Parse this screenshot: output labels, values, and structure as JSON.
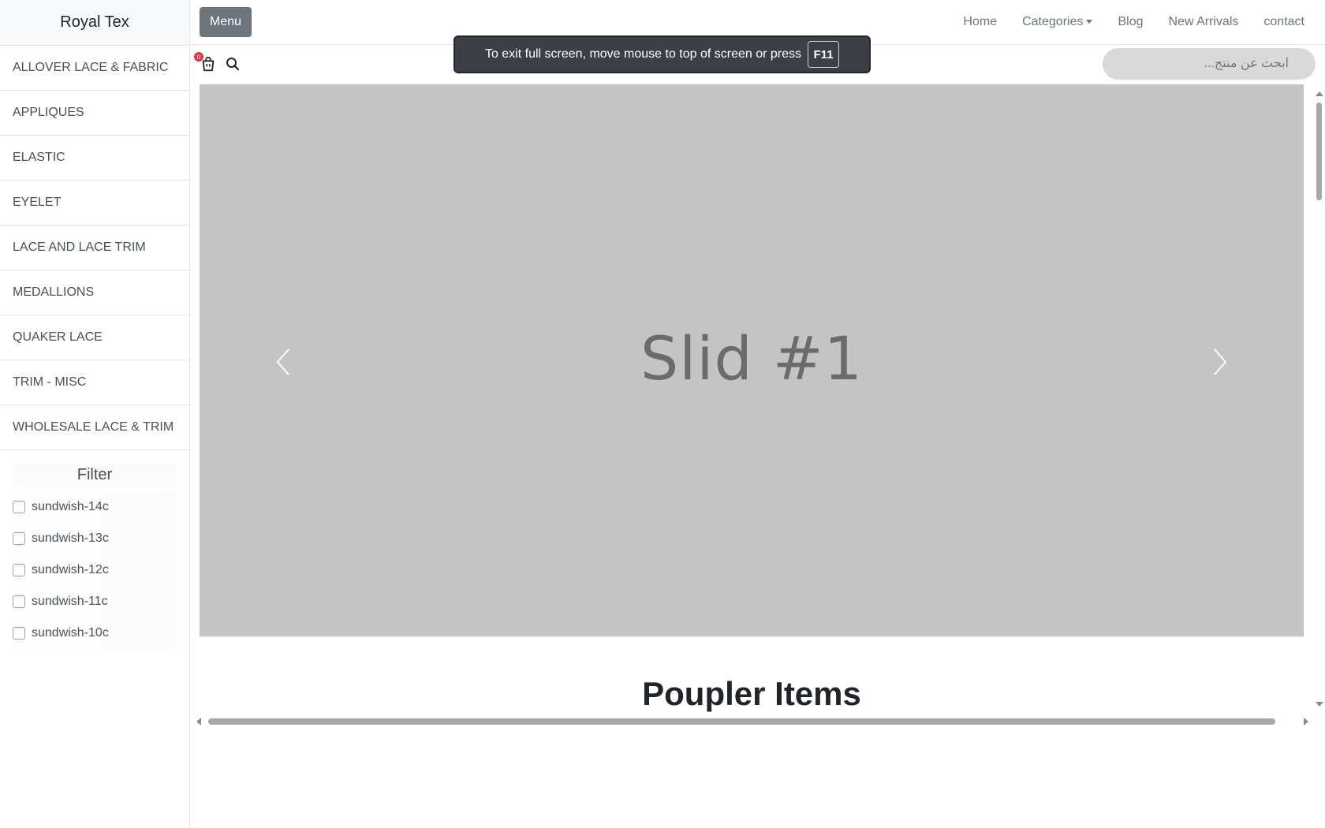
{
  "sidebar": {
    "brand": "Royal Tex",
    "categories": [
      "ALLOVER LACE & FABRIC",
      "APPLIQUES",
      "ELASTIC",
      "EYELET",
      "LACE AND LACE TRIM",
      "MEDALLIONS",
      "QUAKER LACE",
      "TRIM - MISC",
      "WHOLESALE LACE & TRIM"
    ],
    "filter": {
      "title": "Filter",
      "options": [
        "sundwish-14c",
        "sundwish-13c",
        "sundwish-12c",
        "sundwish-11c",
        "sundwish-10c"
      ]
    }
  },
  "header": {
    "menu_label": "Menu",
    "nav": [
      "Home",
      "Categories",
      "Blog",
      "New Arrivals",
      "contact"
    ]
  },
  "toolbar": {
    "cart_count": "0",
    "search_placeholder": "ابحث عن منتج..."
  },
  "toast": {
    "message": "To exit full screen, move mouse to top of screen or press",
    "key": "F11"
  },
  "carousel": {
    "slide_text": "Slid #1"
  },
  "main": {
    "section_title": "Poupler Items"
  },
  "colors": {
    "menu_button": "#6c757d",
    "badge": "#dc3545",
    "carousel_bg": "#c4c4c4"
  }
}
